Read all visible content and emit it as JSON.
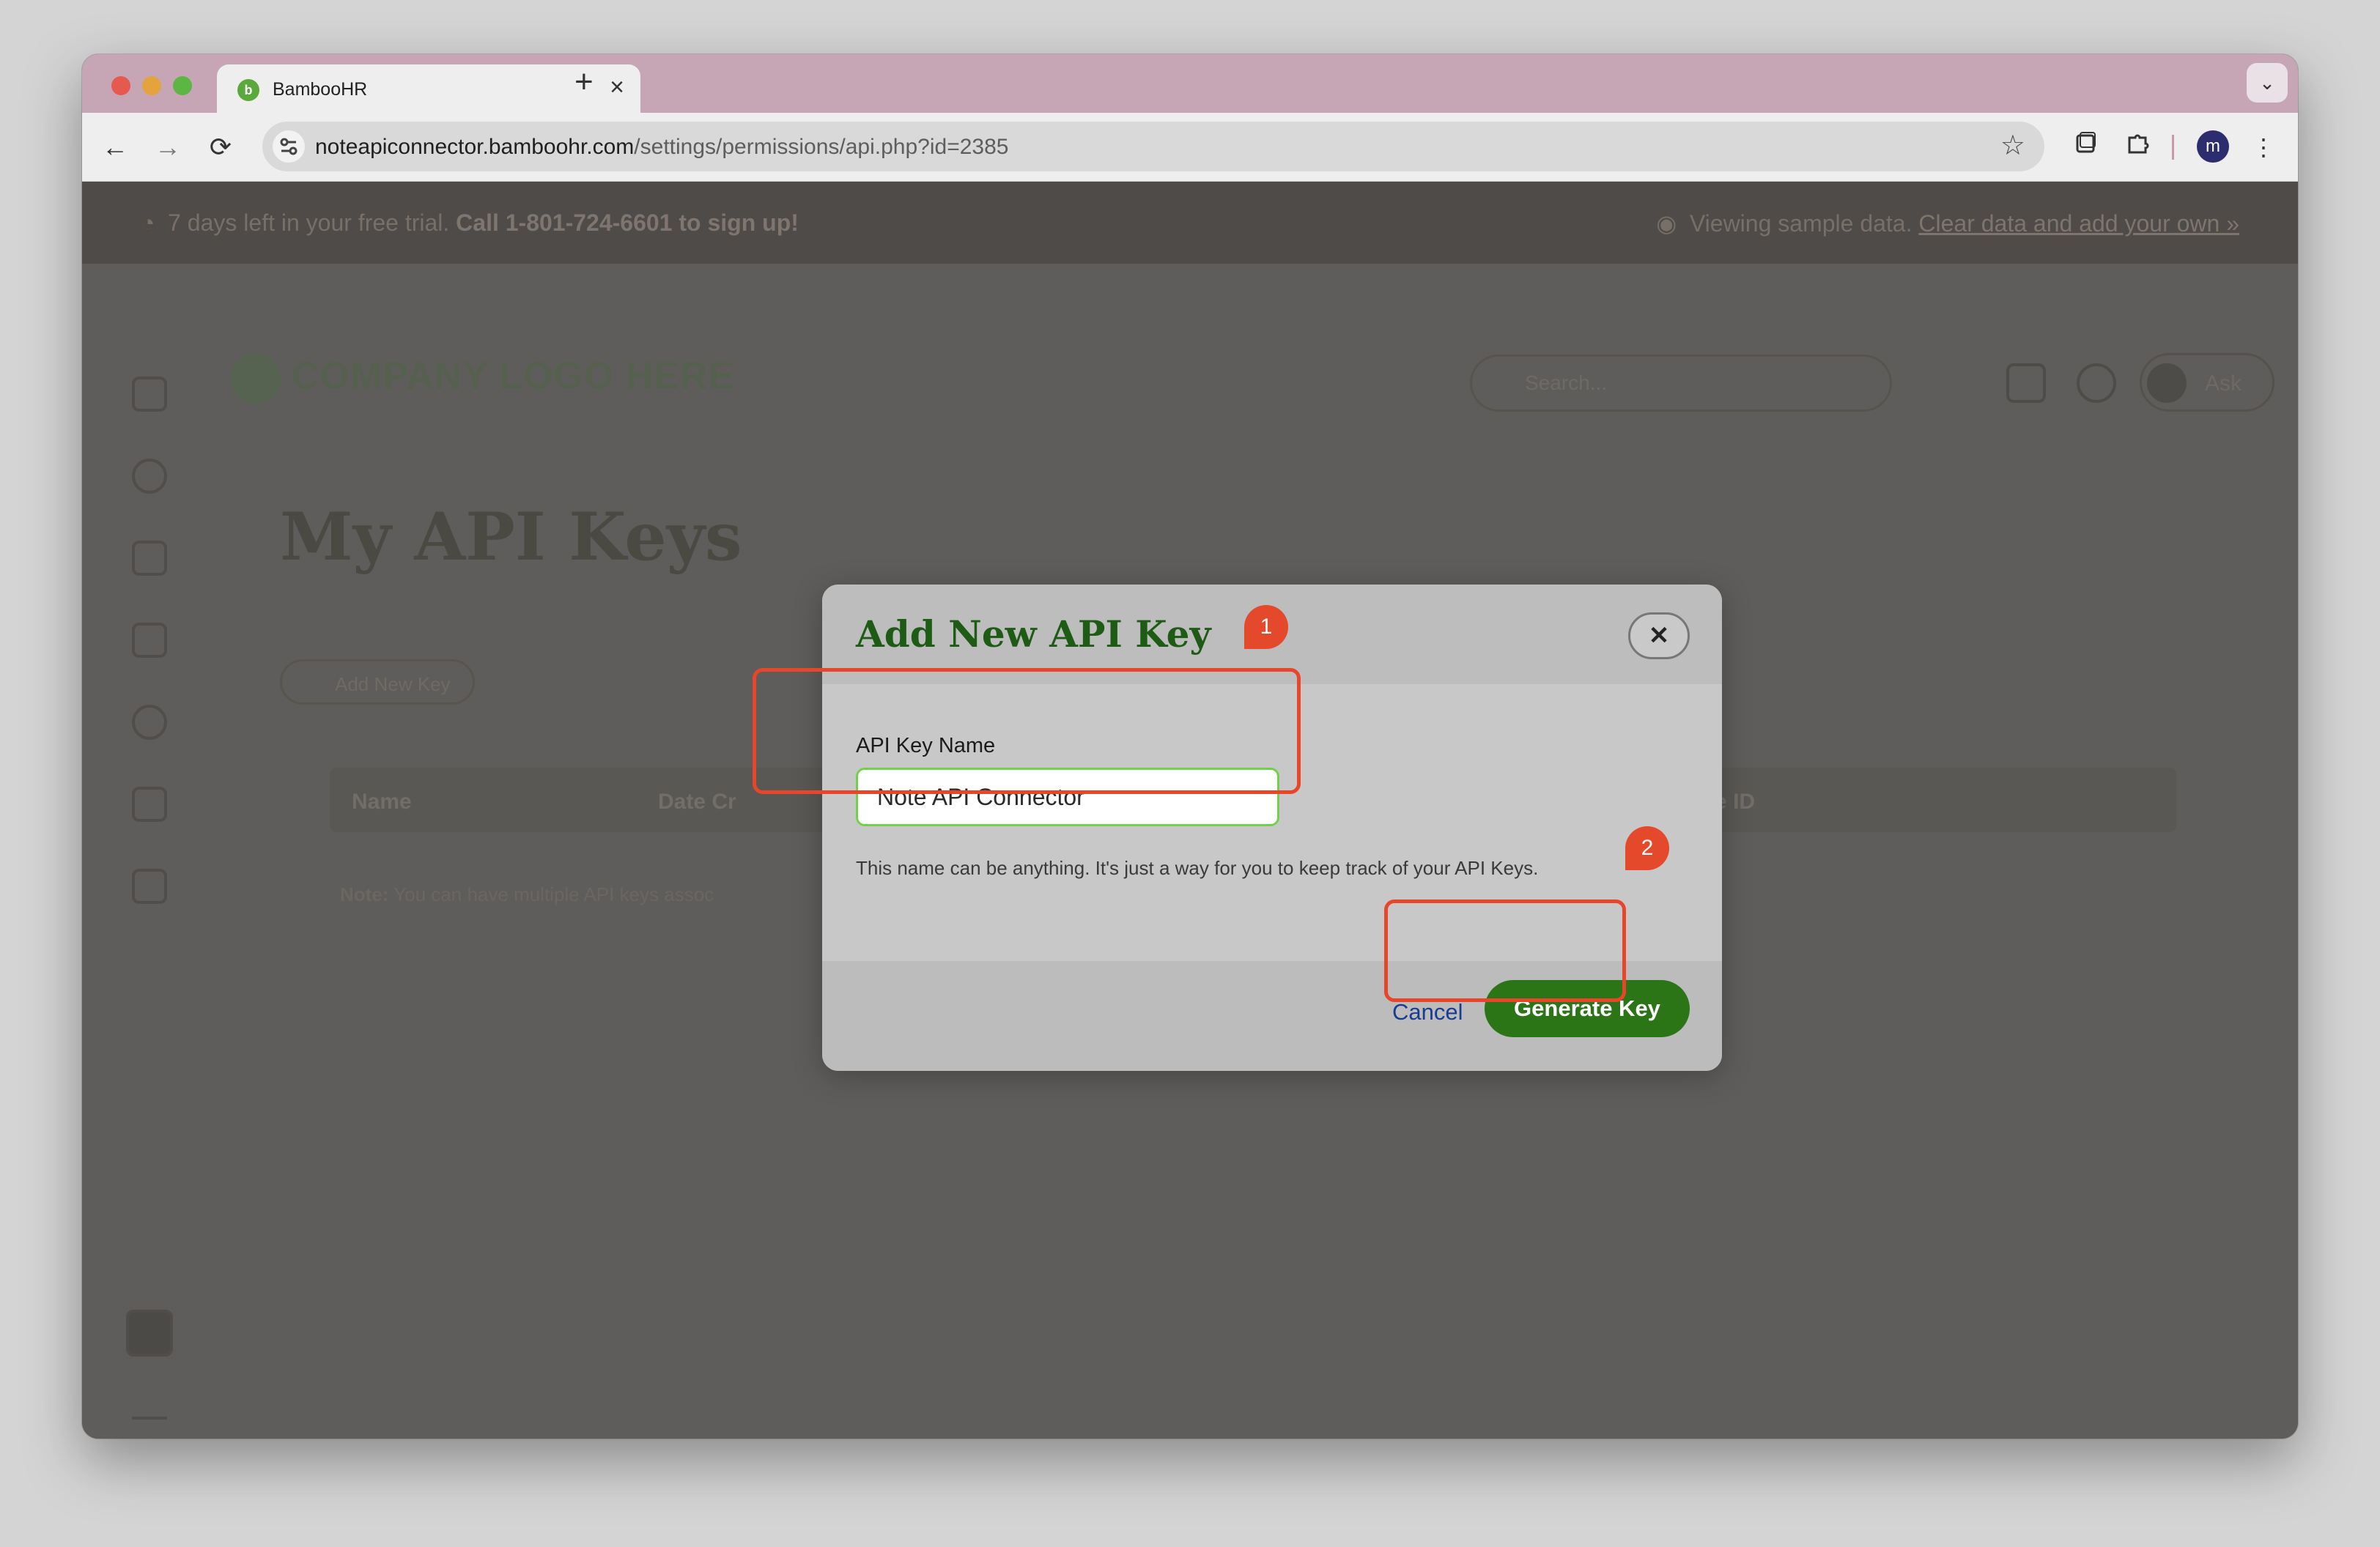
{
  "browser": {
    "tab_title": "BambooHR",
    "tab_close": "×",
    "new_tab": "+",
    "tab_menu": "⌄",
    "back": "←",
    "forward": "→",
    "reload": "⟳",
    "url_domain": "noteapiconnector.bamboohr.com",
    "url_path": "/settings/permissions/api.php?id=2385",
    "profile_initial": "m",
    "menu": "⋮"
  },
  "trial_banner": {
    "left_text": "7 days left in your free trial.",
    "left_call": "Call 1-801-724-6601 to sign up!",
    "right_text": "Viewing sample data.",
    "right_link": "Clear data and add your own »"
  },
  "header": {
    "logo_text": "COMPANY LOGO HERE",
    "search_placeholder": "Search...",
    "ask_label": "Ask"
  },
  "page": {
    "title": "My API Keys",
    "add_new_key_label": "Add New Key",
    "columns": [
      "Name",
      "Date Cr",
      "Device ID"
    ],
    "note_label": "Note:",
    "note_text": "You can have multiple API keys assoc"
  },
  "modal": {
    "title": "Add New API Key",
    "close_label": "✕",
    "field_label": "API Key Name",
    "field_value": "Note API Connector",
    "helper_text": "This name can be anything. It's just a way for you to keep track of your API Keys.",
    "cancel_label": "Cancel",
    "generate_label": "Generate Key"
  },
  "annotations": {
    "marker_1": "1",
    "marker_2": "2",
    "color": "#e8462a"
  },
  "colors": {
    "brand_green": "#2b7516",
    "title_green": "#1e5b15",
    "input_border": "#72d14b",
    "link_blue": "#173d92"
  }
}
